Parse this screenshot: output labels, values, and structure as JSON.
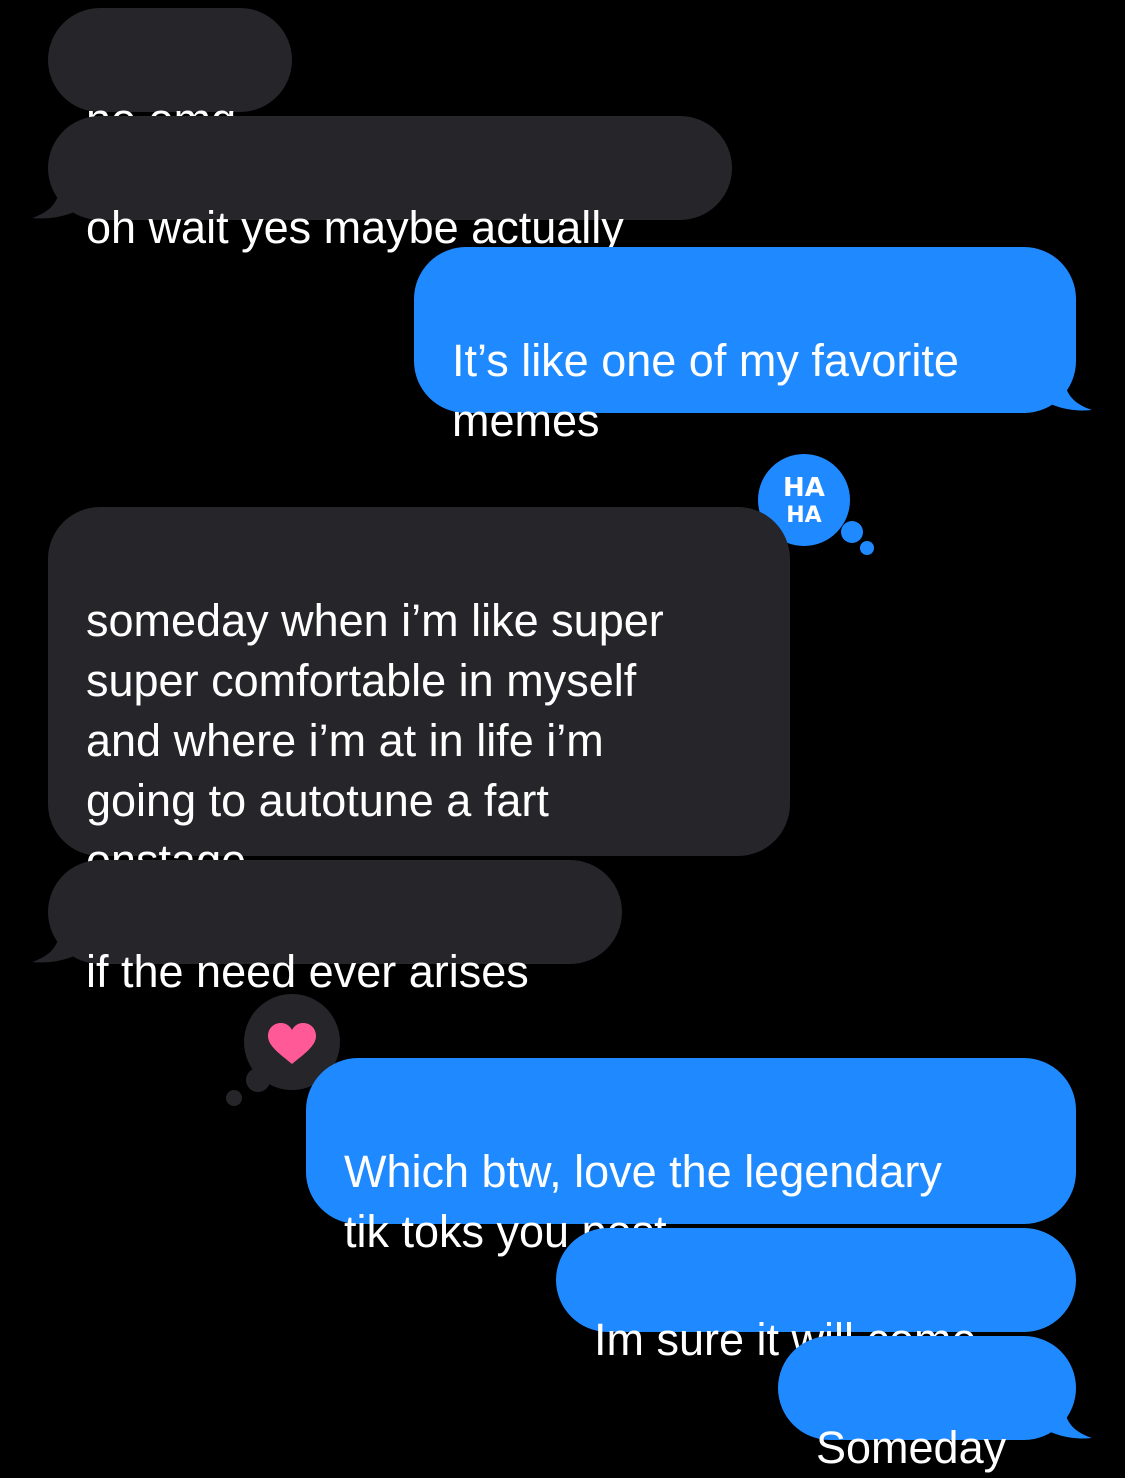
{
  "conversation": {
    "messages": [
      {
        "direction": "incoming",
        "text": "no omg"
      },
      {
        "direction": "incoming",
        "text": "oh wait yes maybe actually"
      },
      {
        "direction": "outgoing",
        "text": "It’s like one of my favorite\nmemes"
      },
      {
        "direction": "incoming",
        "text": "someday when i’m like super\nsuper comfortable in myself\nand where i’m at in life i’m\ngoing to autotune a fart\nonstage"
      },
      {
        "direction": "incoming",
        "text": "if the need ever arises"
      },
      {
        "direction": "outgoing",
        "text": "Which btw, love the legendary\ntik toks you post"
      },
      {
        "direction": "outgoing",
        "text": "Im sure it will come"
      },
      {
        "direction": "outgoing",
        "text": "Someday"
      }
    ],
    "reactions": {
      "haha": {
        "label_top": "HA",
        "label_bottom": "HA",
        "icon": "haha-icon",
        "target": "someday when i’m like super..."
      },
      "heart": {
        "icon": "heart-icon",
        "target": "Which btw, love the legendary..."
      }
    }
  },
  "colors": {
    "background": "#000000",
    "incoming_bubble": "#262529",
    "outgoing_bubble": "#1f8aff",
    "heart": "#ff5a97",
    "text": "#ffffff"
  }
}
